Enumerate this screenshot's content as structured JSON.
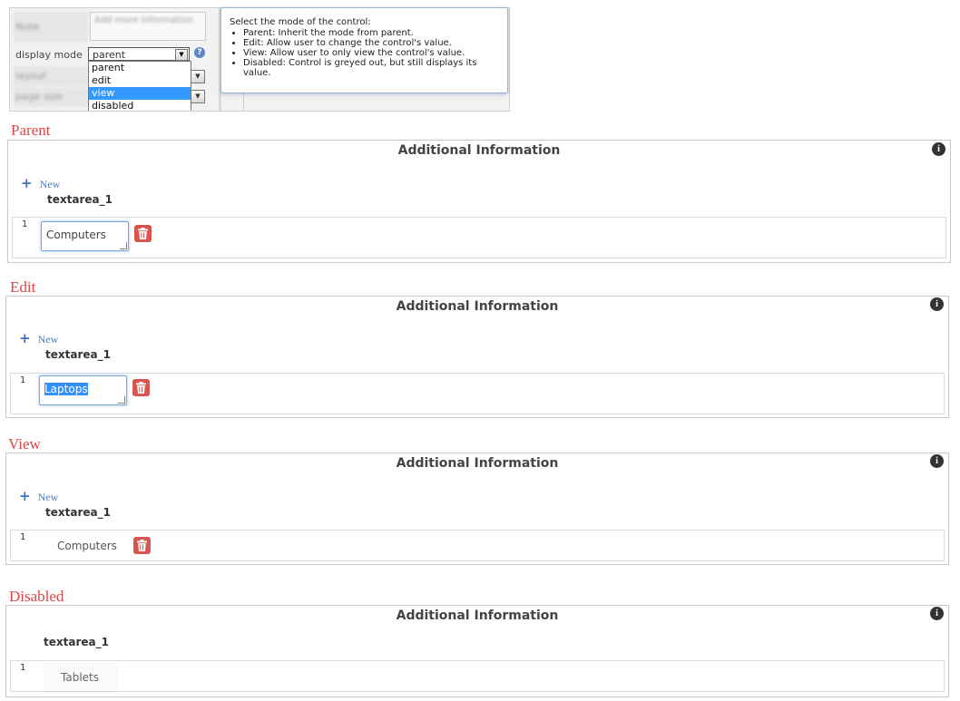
{
  "property_panel": {
    "rows": [
      {
        "label": "Note",
        "blurred": true
      },
      {
        "label": "display mode",
        "blurred": false
      },
      {
        "label": "layout",
        "blurred": true
      },
      {
        "label": "page size",
        "blurred": true
      }
    ],
    "note_value": "Add more information",
    "display_mode": {
      "selected": "parent",
      "options": [
        "parent",
        "edit",
        "view",
        "disabled"
      ],
      "highlighted": "view"
    },
    "tooltip": {
      "title": "Select the mode of the control:",
      "items": [
        "Parent: Inherit the mode from parent.",
        "Edit: Allow user to change the control's value.",
        "View: Allow user to only view the control's value.",
        "Disabled: Control is greyed out, but still displays its value."
      ]
    }
  },
  "sections": [
    {
      "mode_label": "Parent",
      "card_title": "Additional Information",
      "new_label": "New",
      "field": "textarea_1",
      "row_index": "1",
      "value": "Computers",
      "state": "editable"
    },
    {
      "mode_label": "Edit",
      "card_title": "Additional Information",
      "new_label": "New",
      "field": "textarea_1",
      "row_index": "1",
      "value": "Laptops",
      "state": "editable-selected"
    },
    {
      "mode_label": "View",
      "card_title": "Additional Information",
      "new_label": "New",
      "field": "textarea_1",
      "row_index": "1",
      "value": "Computers",
      "state": "view"
    },
    {
      "mode_label": "Disabled",
      "card_title": "Additional Information",
      "field": "textarea_1",
      "row_index": "1",
      "value": "Tablets",
      "state": "disabled"
    }
  ],
  "colors": {
    "mode_title": "#e04545",
    "new_link": "#4a7ec2",
    "delete": "#d9534f",
    "selection": "#3399ff"
  },
  "icons": {
    "info": "info-icon",
    "add": "plus-icon",
    "delete": "trash-icon",
    "help": "help-icon",
    "dropdown": "chevron-down-icon"
  }
}
